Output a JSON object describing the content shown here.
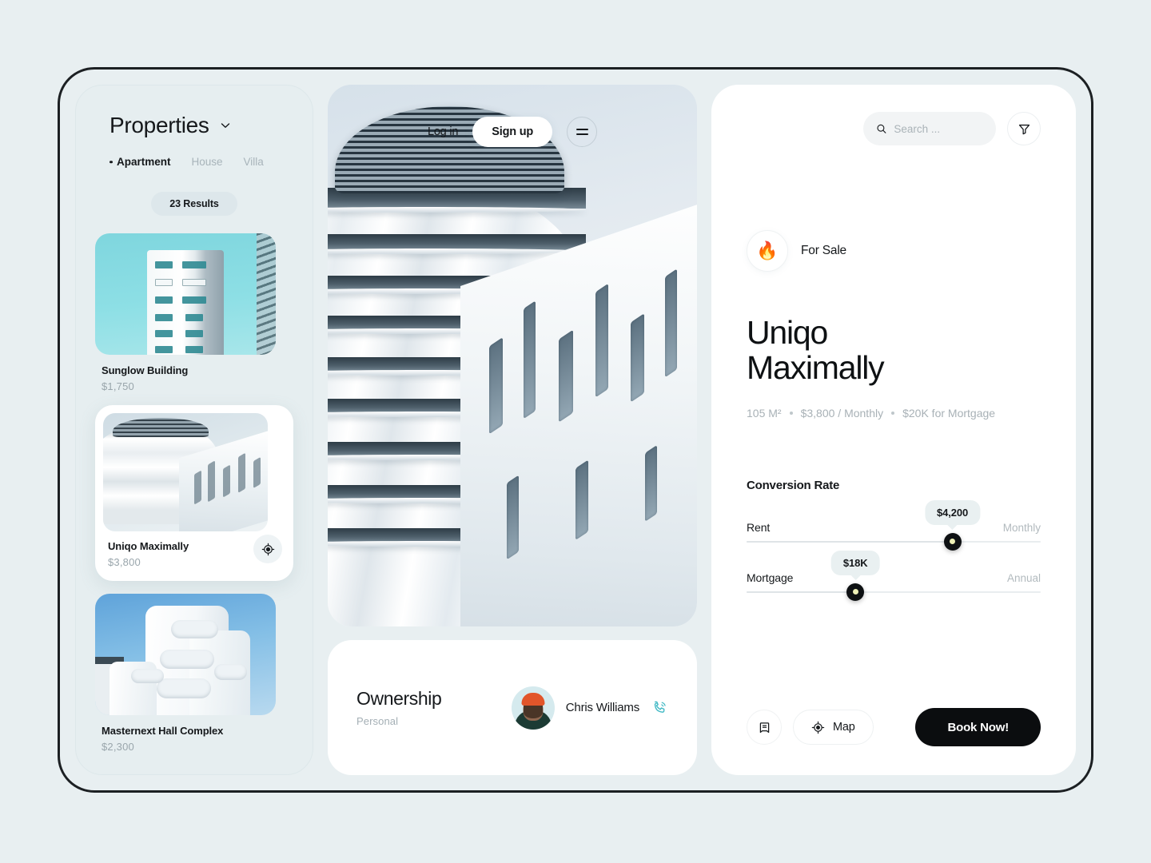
{
  "sidebar": {
    "title": "Properties",
    "dropdown_icon": "chevron-down-icon",
    "tabs": [
      {
        "label": "Apartment",
        "active": true
      },
      {
        "label": "House",
        "active": false
      },
      {
        "label": "Villa",
        "active": false
      }
    ],
    "results_count": "23 Results",
    "properties": [
      {
        "name": "Sunglow Building",
        "price": "$1,750",
        "active": false
      },
      {
        "name": "Uniqo Maximally",
        "price": "$3,800",
        "active": true,
        "locate_icon": "target-locate-icon"
      },
      {
        "name": "Masternext Hall Complex",
        "price": "$2,300",
        "active": false
      }
    ]
  },
  "hero": {
    "login_label": "Log in",
    "signup_label": "Sign up",
    "menu_icon": "hamburger-menu-icon"
  },
  "ownership": {
    "title": "Ownership",
    "subtitle": "Personal",
    "owner_name": "Chris Williams",
    "phone_icon": "phone-call-icon",
    "avatar_name": "owner-avatar"
  },
  "detail": {
    "search": {
      "placeholder": "Search ...",
      "value": "",
      "icon": "search-icon"
    },
    "filter_icon": "filter-funnel-icon",
    "status_badge": {
      "icon": "fire-icon",
      "emoji": "🔥",
      "label": "For Sale"
    },
    "title_line1": "Uniqo",
    "title_line2": "Maximally",
    "specs": [
      "105 M²",
      "$3,800 / Monthly",
      "$20K for Mortgage"
    ],
    "conversion": {
      "heading": "Conversion Rate",
      "sliders": [
        {
          "name": "Rent",
          "value_label": "$4,200",
          "unit": "Monthly",
          "percent": 70
        },
        {
          "name": "Mortgage",
          "value_label": "$18K",
          "unit": "Annual",
          "percent": 37
        }
      ]
    },
    "actions": {
      "bookmark_icon": "bookmark-icon",
      "map_label": "Map",
      "map_icon": "target-locate-icon",
      "book_label": "Book Now!"
    }
  },
  "colors": {
    "page_bg": "#e8eff1",
    "sidebar_bg": "#e6eef0",
    "card_white": "#ffffff",
    "accent_dark": "#0b0d0f",
    "thumb_accent": "#edf0b6",
    "muted_text": "#a8b1b6",
    "phone_teal": "#3fb8c4"
  }
}
